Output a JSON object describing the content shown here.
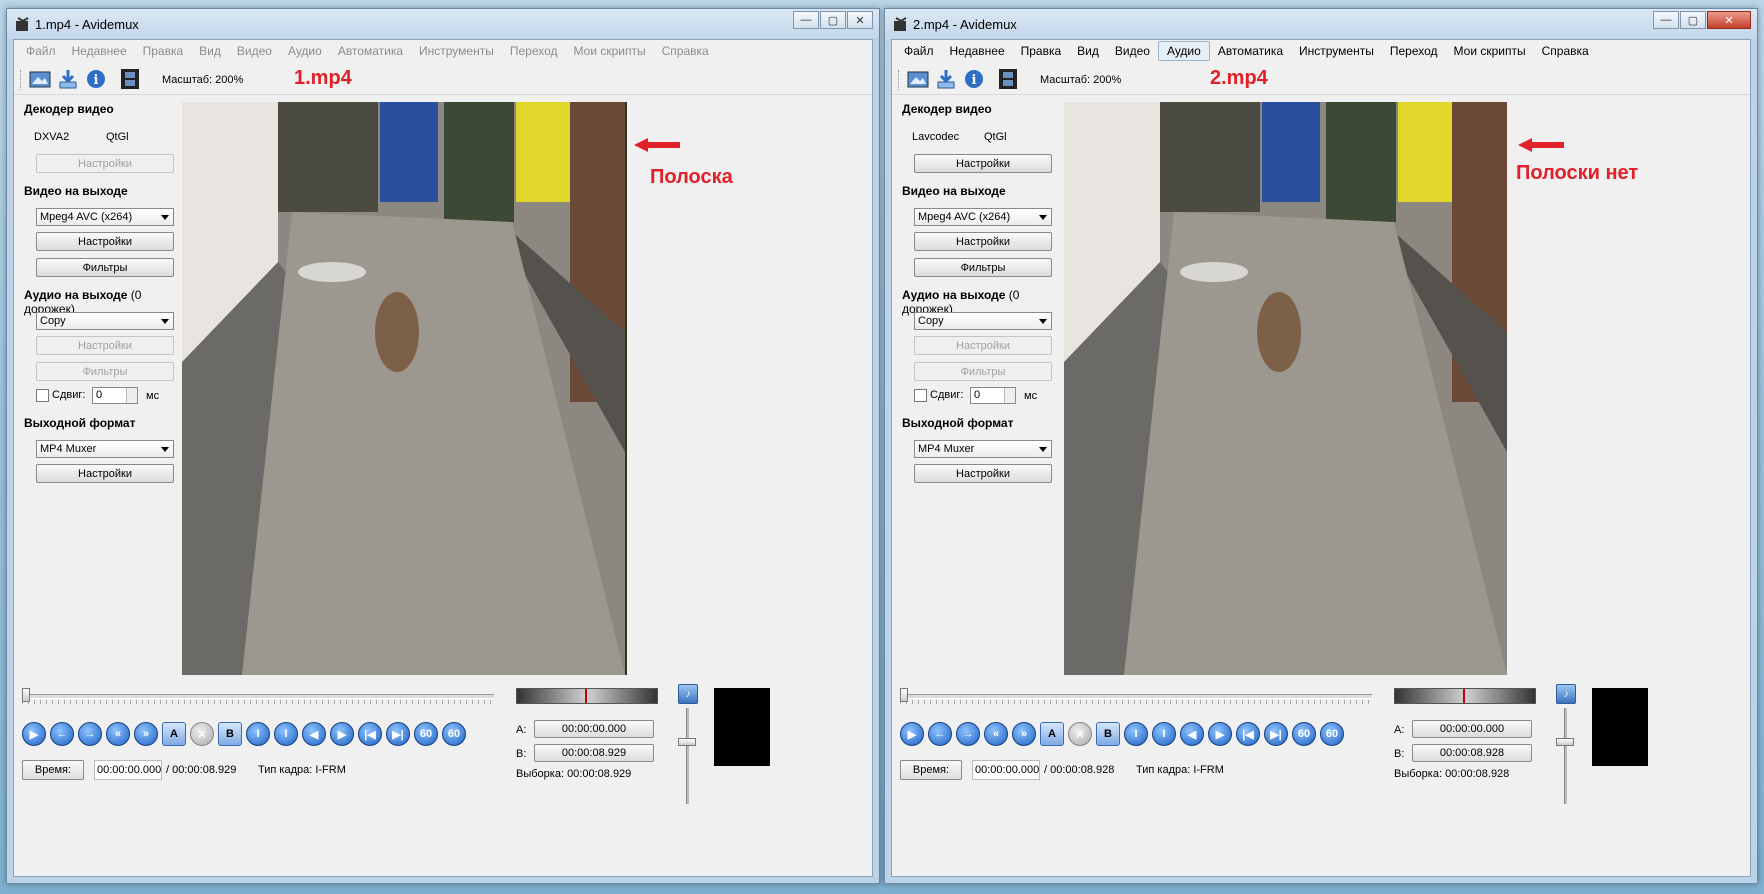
{
  "windows": [
    {
      "title": "1.mp4 - Avidemux",
      "menu": [
        "Файл",
        "Недавнее",
        "Правка",
        "Вид",
        "Видео",
        "Аудио",
        "Автоматика",
        "Инструменты",
        "Переход",
        "Мои скрипты",
        "Справка"
      ],
      "menu_active": "",
      "zoom": "Масштаб: 200%",
      "file_annotation": "1.mp4",
      "strip_annotation": "Полоска",
      "video_decoder_title": "Декодер видео",
      "decoder_name": "DXVA2",
      "decoder_lib": "QtGl",
      "decoder_settings": "Настройки",
      "video_out_title": "Видео на выходе",
      "video_codec": "Mpeg4 AVC (x264)",
      "video_settings": "Настройки",
      "video_filters": "Фильтры",
      "audio_out_title": "Аудио на выходе",
      "audio_tracks": "(0 дорожек)",
      "audio_codec": "Copy",
      "audio_settings": "Настройки",
      "audio_filters": "Фильтры",
      "shift_label": "Сдвиг:",
      "shift_value": "0",
      "shift_unit": "мс",
      "format_title": "Выходной формат",
      "muxer": "MP4 Muxer",
      "format_settings": "Настройки",
      "time_button": "Время:",
      "time_current": "00:00:00.000",
      "time_total": "/ 00:00:08.929",
      "frame_type": "Тип кадра:  I-FRM",
      "a_label": "A:",
      "a_value": "00:00:00.000",
      "b_label": "B:",
      "b_value": "00:00:08.929",
      "selection": "Выборка: 00:00:08.929",
      "fps_label": "60"
    },
    {
      "title": "2.mp4 - Avidemux",
      "menu": [
        "Файл",
        "Недавнее",
        "Правка",
        "Вид",
        "Видео",
        "Аудио",
        "Автоматика",
        "Инструменты",
        "Переход",
        "Мои скрипты",
        "Справка"
      ],
      "menu_active": "Аудио",
      "zoom": "Масштаб: 200%",
      "file_annotation": "2.mp4",
      "strip_annotation": "Полоски нет",
      "video_decoder_title": "Декодер видео",
      "decoder_name": "Lavcodec",
      "decoder_lib": "QtGl",
      "decoder_settings": "Настройки",
      "video_out_title": "Видео на выходе",
      "video_codec": "Mpeg4 AVC (x264)",
      "video_settings": "Настройки",
      "video_filters": "Фильтры",
      "audio_out_title": "Аудио на выходе",
      "audio_tracks": "(0 дорожек)",
      "audio_codec": "Copy",
      "audio_settings": "Настройки",
      "audio_filters": "Фильтры",
      "shift_label": "Сдвиг:",
      "shift_value": "0",
      "shift_unit": "мс",
      "format_title": "Выходной формат",
      "muxer": "MP4 Muxer",
      "format_settings": "Настройки",
      "time_button": "Время:",
      "time_current": "00:00:00.000",
      "time_total": "/ 00:00:08.928",
      "frame_type": "Тип кадра:  I-FRM",
      "a_label": "A:",
      "a_value": "00:00:00.000",
      "b_label": "B:",
      "b_value": "00:00:08.928",
      "selection": "Выборка: 00:00:08.928",
      "fps_label": "60"
    }
  ],
  "colors": {
    "annotation": "#e2202a",
    "frame_strip": "#2a3a22"
  },
  "icons": [
    "open-icon",
    "save-icon",
    "info-icon",
    "film-icon",
    "play-icon",
    "prev-icon",
    "next-icon",
    "rewind-icon",
    "forward-icon",
    "marker-a-icon",
    "delete-icon",
    "marker-b-icon",
    "prev-keyframe-icon",
    "next-keyframe-icon",
    "prev-black-icon",
    "next-black-icon",
    "first-frame-icon",
    "last-frame-icon",
    "back-60-icon",
    "forward-60-icon",
    "volume-icon"
  ]
}
